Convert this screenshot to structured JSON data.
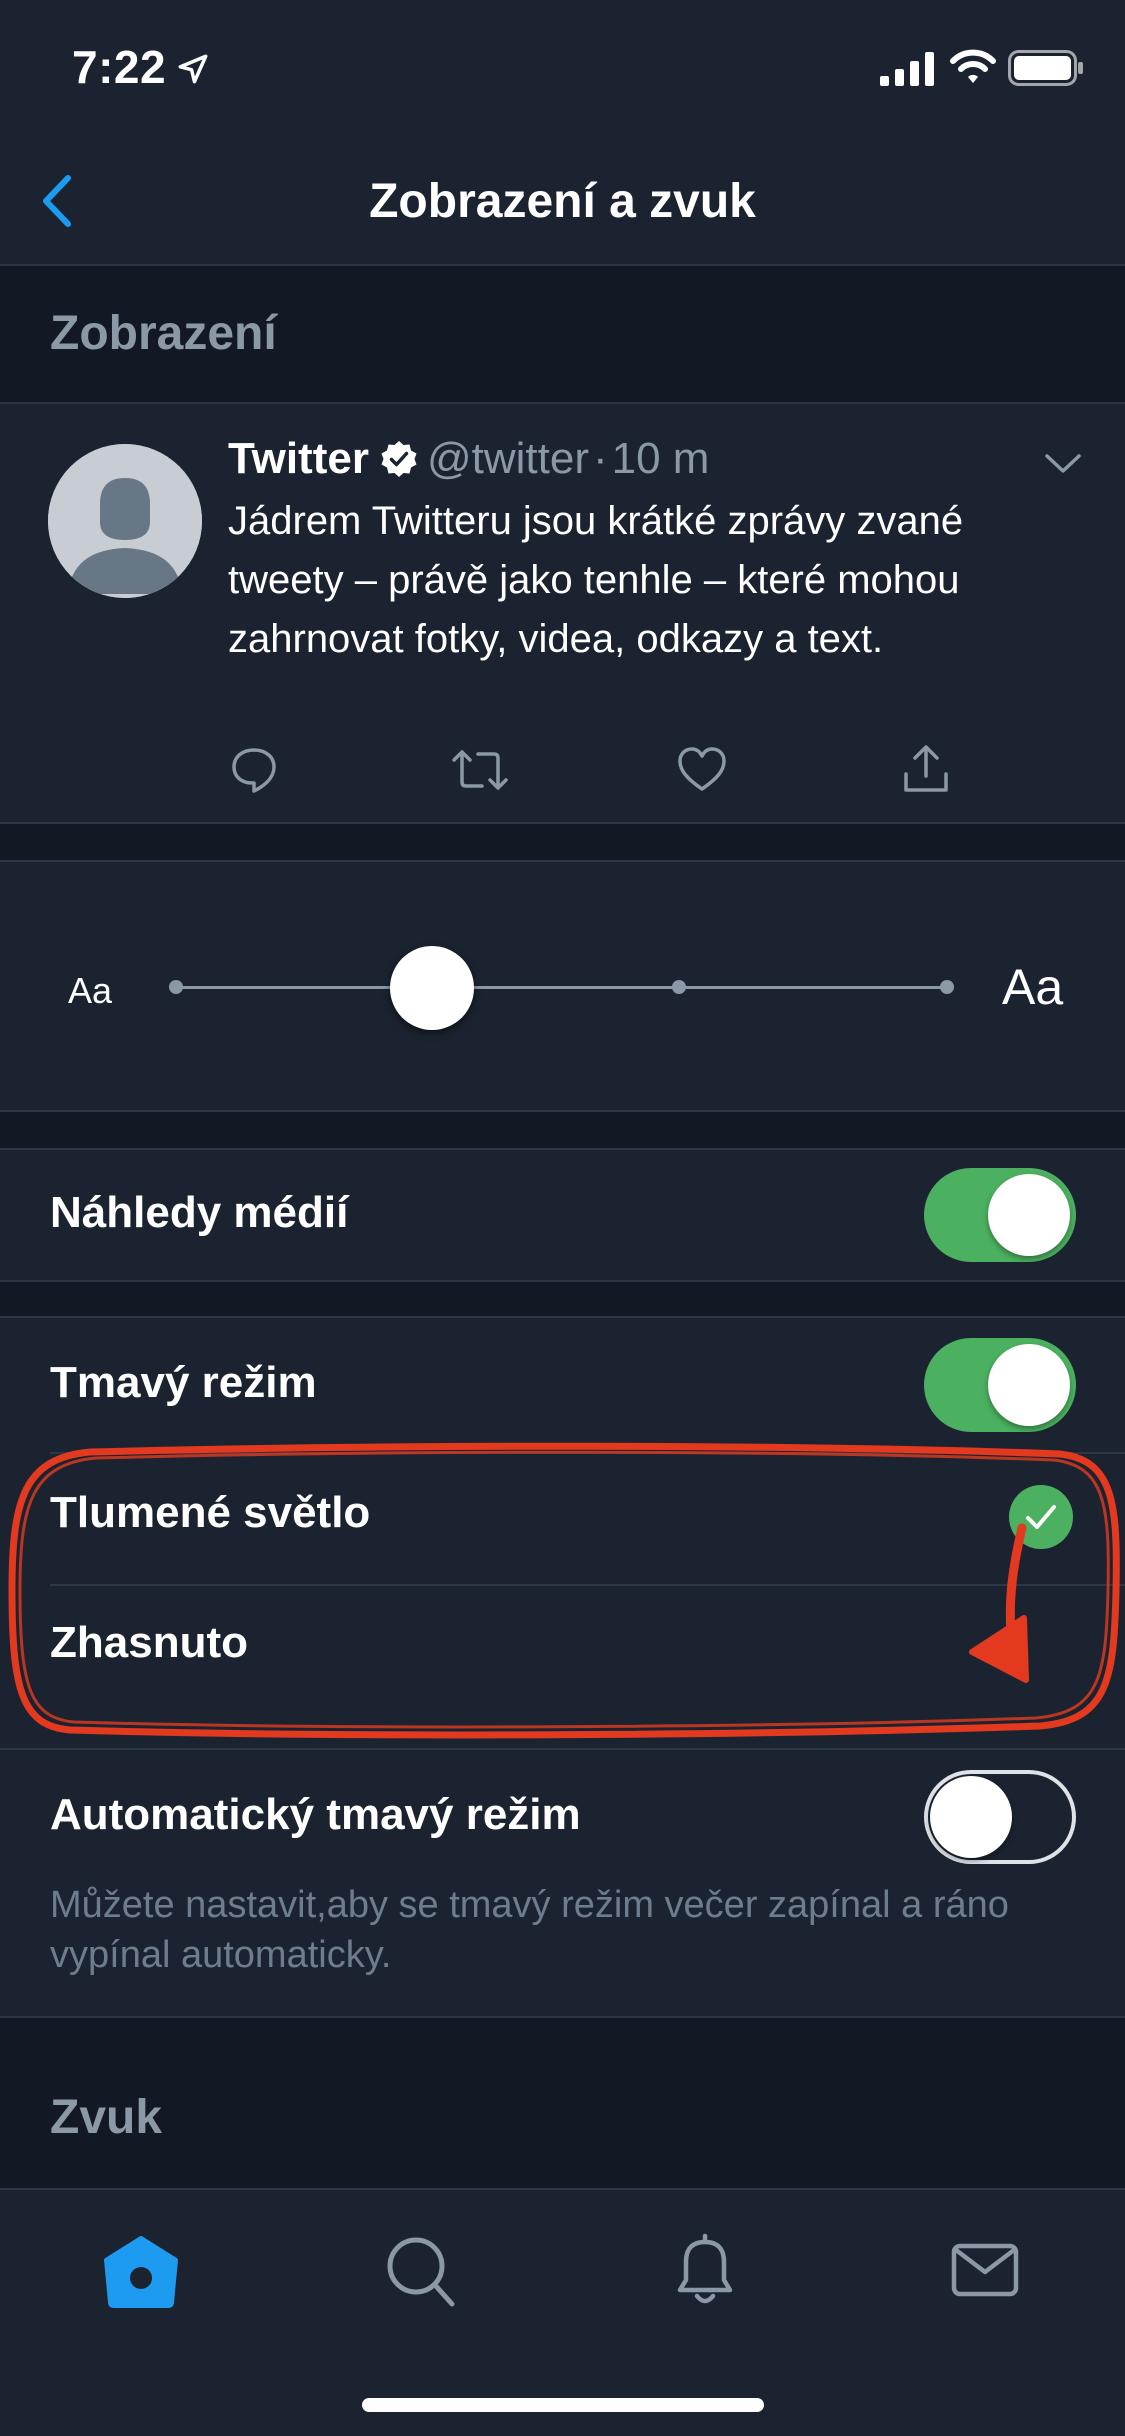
{
  "status_bar": {
    "time": "7:22",
    "icons": [
      "location-arrow-icon",
      "signal-icon",
      "wifi-icon",
      "battery-icon"
    ]
  },
  "nav": {
    "title": "Zobrazení a zvuk",
    "back_icon": "chevron-left-icon"
  },
  "sections": {
    "display": "Zobrazení",
    "sound": "Zvuk"
  },
  "tweet": {
    "name": "Twitter",
    "handle": "@twitter",
    "separator": "·",
    "time": "10 m",
    "text": "Jádrem Twitteru jsou krátké zprávy zvané tweety – právě jako tenhle – které mohou zahrnovat fotky, videa, odkazy a text.",
    "actions": [
      "reply-icon",
      "retweet-icon",
      "like-icon",
      "share-icon"
    ]
  },
  "font_size": {
    "small_label": "Aa",
    "large_label": "Aa",
    "steps": 4,
    "selected_step": 2
  },
  "settings": {
    "media_previews": {
      "label": "Náhledy médií",
      "on": true
    },
    "dark_mode": {
      "label": "Tmavý režim",
      "on": true
    },
    "dim": {
      "label": "Tlumené světlo",
      "selected": true
    },
    "lights_out": {
      "label": "Zhasnuto",
      "selected": false
    },
    "auto_dark_mode": {
      "label": "Automatický tmavý režim",
      "on": false,
      "description": "Můžete nastavit,aby se tmavý režim večer zapínal a ráno vypínal automaticky."
    }
  },
  "tab_bar": {
    "tabs": [
      "home-icon",
      "search-icon",
      "notifications-icon",
      "messages-icon"
    ],
    "active": "home-icon"
  },
  "colors": {
    "background": "#131924",
    "surface": "#1b2330",
    "accent": "#1d9bf0",
    "toggle_on": "#4bb160",
    "annotation": "#e2391f",
    "secondary_text": "#8b98a5"
  }
}
